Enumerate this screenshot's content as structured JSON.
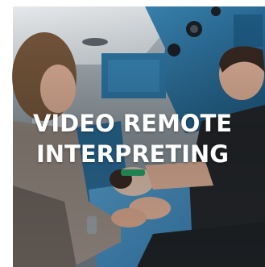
{
  "tile": {
    "title_line_1": "VIDEO REMOTE",
    "title_line_2": "INTERPRETING",
    "text_color": "#ffffff"
  },
  "photo": {
    "subject": "ambulance-interior-photo",
    "colors": {
      "ceiling": "#e9edf0",
      "cabinet_blue": "#2f79a8",
      "wall_grey": "#8e9aa2",
      "dark_shadow": "#2a3036",
      "skin": "#e3b49b",
      "hair_brown": "#7a5a3e",
      "dark_hair": "#3a2a22",
      "blanket_blue": "#3f8fc7",
      "dark_shirt": "#25282c"
    }
  }
}
